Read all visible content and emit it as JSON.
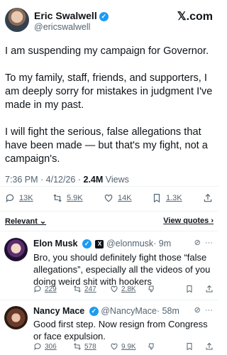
{
  "author": {
    "name": "Eric Swalwell",
    "handle": "@ericswalwell"
  },
  "site_label": "𝕏.com",
  "tweet": {
    "paragraphs": [
      "I am suspending my campaign for Governor.",
      "To my family, staff, friends, and supporters, I am deeply sorry for mistakes in judgment I've made in my past.",
      "I will fight the serious, false allegations that have been made — but that's my fight, not a campaign's."
    ],
    "time": "7:36 PM · 4/12/26 ·",
    "views_count": "2.4M",
    "views_label": "Views"
  },
  "actions": {
    "replies": "13K",
    "reposts": "5.9K",
    "likes": "14K",
    "bookmarks": "1.3K"
  },
  "filter": {
    "sort_label": "Relevant",
    "quotes_label": "View quotes"
  },
  "replies": [
    {
      "name": "Elon Musk",
      "handle": "@elonmusk",
      "time": "· 9m",
      "text": "Bro, you should definitely fight those “false allegations”, especially all the videos of you doing weird shit with hookers",
      "counts": {
        "replies": "229",
        "reposts": "247",
        "likes": "2.8K"
      }
    },
    {
      "name": "Nancy Mace",
      "handle": "@NancyMace",
      "time": "· 58m",
      "text": "Good first step. Now resign from Congress or face expulsion.",
      "counts": {
        "replies": "306",
        "reposts": "578",
        "likes": "9.9K"
      }
    }
  ],
  "colors": {
    "verified_blue": "#1d9bf0",
    "muted_text": "#536471",
    "primary_text": "#0f1419"
  }
}
